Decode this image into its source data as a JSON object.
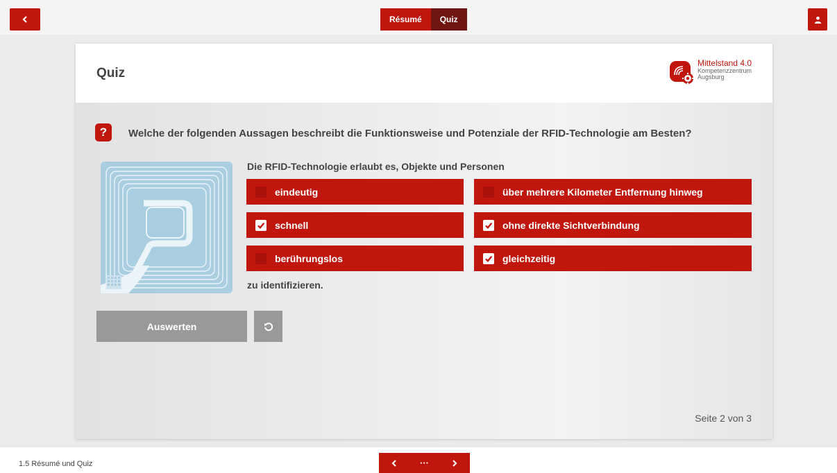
{
  "header": {
    "back_label": "‹",
    "tabs": [
      {
        "label": "Résumé"
      },
      {
        "label": "Quiz"
      }
    ]
  },
  "card": {
    "title": "Quiz",
    "logo": {
      "title": "Mittelstand 4.0",
      "sub1": "Kompetenzzentrum",
      "sub2": "Augsburg"
    },
    "question_icon": "?",
    "question": "Welche der folgenden Aussagen beschreibt die Funktionsweise und Potenziale der RFID-Technologie am Besten?",
    "sentence_start": "Die RFID-Technologie erlaubt es, Objekte und Personen",
    "sentence_end": "zu identifizieren.",
    "options": [
      {
        "label": "eindeutig",
        "checked": false
      },
      {
        "label": "über mehrere Kilometer Entfernung hinweg",
        "checked": false
      },
      {
        "label": "schnell",
        "checked": true
      },
      {
        "label": "ohne direkte Sichtverbindung",
        "checked": true
      },
      {
        "label": "berührungslos",
        "checked": false
      },
      {
        "label": "gleichzeitig",
        "checked": true
      }
    ],
    "evaluate_label": "Auswerten",
    "page_info": "Seite 2 von 3"
  },
  "footer": {
    "label": "1.5 Résumé und Quiz",
    "prev": "‹",
    "menu": "···",
    "next": "›"
  },
  "colors": {
    "accent": "#c0160d",
    "accent_dark": "#6f1512",
    "button_gray": "#999999"
  },
  "icons": [
    "chevron-left-icon",
    "user-icon",
    "question-icon",
    "rfid-tag-image",
    "checkmark-icon",
    "reset-icon",
    "chevron-right-icon",
    "ellipsis-icon"
  ]
}
